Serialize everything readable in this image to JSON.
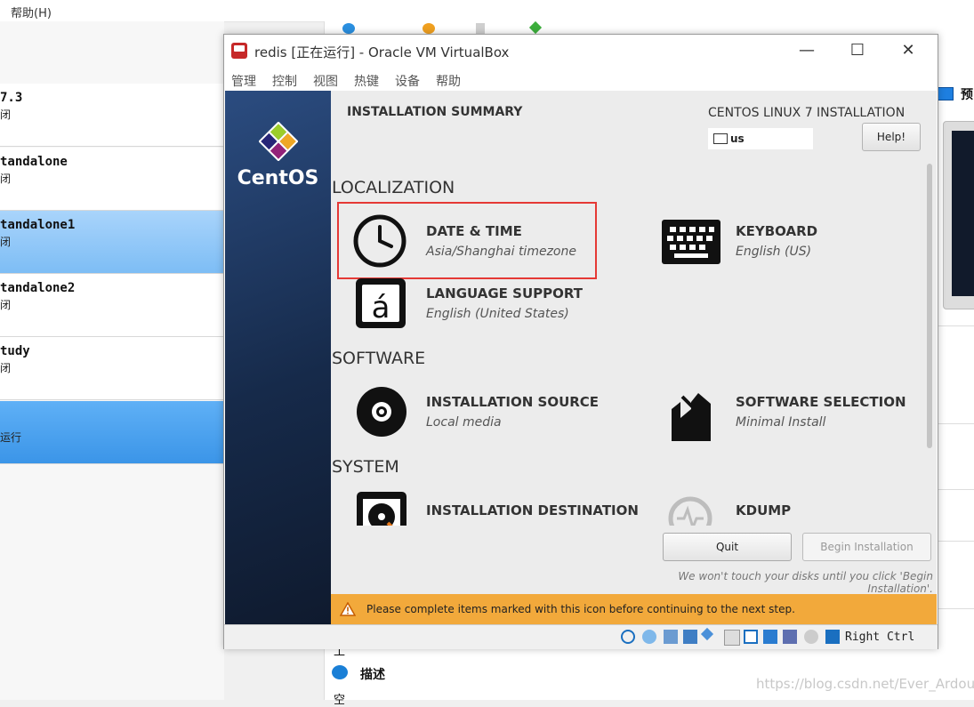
{
  "background": {
    "help_menu": "帮助(H)",
    "vm_list": [
      {
        "name": "7.3",
        "status": "闭"
      },
      {
        "name": "tandalone",
        "status": "闭"
      },
      {
        "name": "tandalone1",
        "status": "闭"
      },
      {
        "name": "tandalone2",
        "status": "闭"
      },
      {
        "name": "tudy",
        "status": "闭"
      },
      {
        "name": "",
        "status": "运行"
      }
    ],
    "preview_label": "预",
    "description_label": "描述",
    "detail_fragment_1": "工",
    "detail_fragment_2": "空",
    "watermark": "https://blog.csdn.net/Ever_Ardour"
  },
  "vm_window": {
    "title": "redis [正在运行] - Oracle VM VirtualBox",
    "controls": {
      "minimize": "—",
      "maximize": "☐",
      "close": "✕"
    },
    "menu": [
      "管理",
      "控制",
      "视图",
      "热键",
      "设备",
      "帮助"
    ],
    "host_key": "Right Ctrl"
  },
  "installer": {
    "brand": "CentOS",
    "summary_title": "INSTALLATION SUMMARY",
    "product_title": "CENTOS LINUX 7 INSTALLATION",
    "keyboard_layout": "us",
    "help_button": "Help!",
    "sections": {
      "localization": "LOCALIZATION",
      "software": "SOFTWARE",
      "system": "SYSTEM"
    },
    "spokes": {
      "date_time": {
        "name": "DATE & TIME",
        "status": "Asia/Shanghai timezone"
      },
      "keyboard": {
        "name": "KEYBOARD",
        "status": "English (US)"
      },
      "language": {
        "name": "LANGUAGE SUPPORT",
        "status": "English (United States)"
      },
      "install_source": {
        "name": "INSTALLATION SOURCE",
        "status": "Local media"
      },
      "software_selection": {
        "name": "SOFTWARE SELECTION",
        "status": "Minimal Install"
      },
      "install_destination": {
        "name": "INSTALLATION DESTINATION",
        "status": ""
      },
      "kdump": {
        "name": "KDUMP",
        "status": ""
      }
    },
    "quit_button": "Quit",
    "begin_button": "Begin Installation",
    "disk_note": "We won't touch your disks until you click 'Begin Installation'.",
    "warning_text": "Please complete items marked with this icon before continuing to the next step.",
    "colors": {
      "warning_bar": "#f2a93b",
      "sidebar": "#1c3459",
      "highlight": "#e53935"
    }
  }
}
